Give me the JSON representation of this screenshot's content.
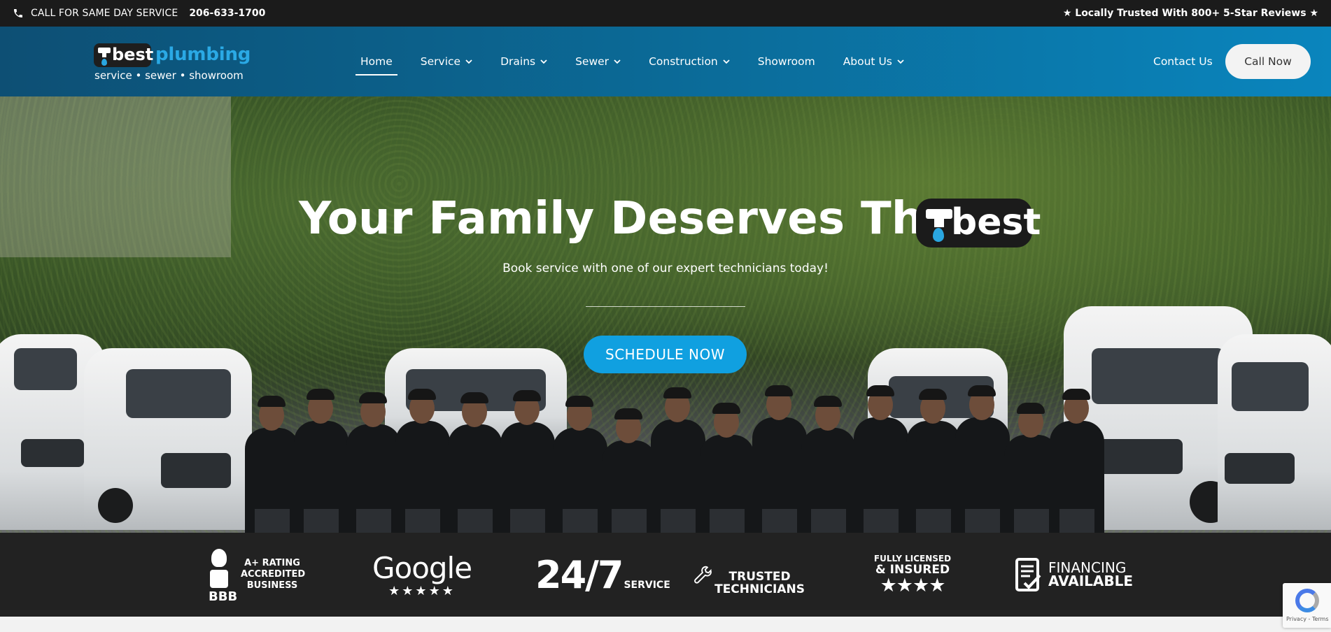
{
  "topbar": {
    "cta": "CALL FOR SAME DAY SERVICE",
    "phone": "206-633-1700",
    "reviews": "★ Locally Trusted With 800+ 5-Star Reviews ★"
  },
  "logo": {
    "word_left": "best",
    "word_right": "plumbing",
    "tagline": "service • sewer • showroom"
  },
  "nav": {
    "items": [
      {
        "label": "Home",
        "active": true,
        "dropdown": false
      },
      {
        "label": "Service",
        "active": false,
        "dropdown": true
      },
      {
        "label": "Drains",
        "active": false,
        "dropdown": true
      },
      {
        "label": "Sewer",
        "active": false,
        "dropdown": true
      },
      {
        "label": "Construction",
        "active": false,
        "dropdown": true
      },
      {
        "label": "Showroom",
        "active": false,
        "dropdown": false
      },
      {
        "label": "About Us",
        "active": false,
        "dropdown": true
      }
    ],
    "contact": "Contact Us",
    "call_now": "Call Now"
  },
  "hero": {
    "title": "Your Family Deserves The",
    "badge_word": "best",
    "subtitle": "Book service with one of our expert technicians today!",
    "button": "SCHEDULE NOW"
  },
  "trust": {
    "bbb": {
      "logo": "BBB",
      "text": "A+ RATING ACCREDITED BUSINESS"
    },
    "google": {
      "logo": "Google",
      "stars": "★★★★★"
    },
    "support": {
      "big": "24/7",
      "label": "SERVICE"
    },
    "technicians": {
      "line1": "TRUSTED",
      "line2": "TECHNICIANS"
    },
    "licensed": {
      "line1": "FULLY LICENSED",
      "line2": "& INSURED",
      "stars": "★★★★"
    },
    "financing": {
      "line1": "FINANCING",
      "line2": "AVAILABLE"
    }
  },
  "recaptcha": {
    "text": "Privacy - Terms"
  },
  "colors": {
    "accent": "#10a0e0",
    "topbar": "#1b1b1b",
    "header_start": "#0d4f74",
    "header_end": "#0a85bd",
    "trustbar": "#222222"
  }
}
